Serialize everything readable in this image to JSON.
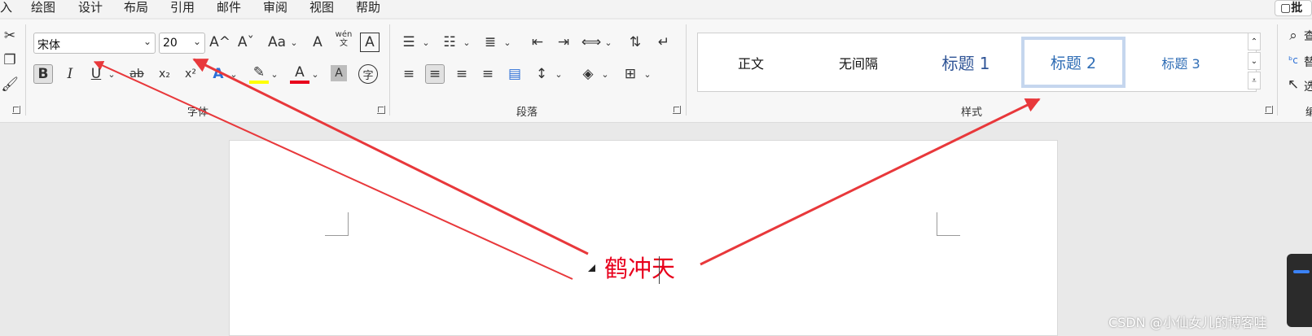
{
  "menubar": {
    "items": [
      "入",
      "绘图",
      "设计",
      "布局",
      "引用",
      "邮件",
      "审阅",
      "视图",
      "帮助"
    ],
    "comment_label": "批"
  },
  "font_group": {
    "label": "字体",
    "font_name": "宋体",
    "font_size": "20",
    "grow_font": "A^",
    "shrink_font": "Aˇ",
    "change_case": "Aa",
    "phonetic_top": "wén",
    "phonetic_bottom": "文",
    "bold": "B",
    "italic": "I",
    "underline": "U",
    "strikethrough": "ab",
    "subscript": "x₂",
    "superscript": "x²",
    "text_effects": "A",
    "font_color": "A",
    "char_shading": "A",
    "enclose_char": "字"
  },
  "paragraph_group": {
    "label": "段落"
  },
  "styles_group": {
    "label": "样式",
    "styles": [
      "正文",
      "无间隔",
      "标题 1",
      "标题 2",
      "标题 3"
    ],
    "selected": "标题 2"
  },
  "editing_group": {
    "find": "查",
    "replace": "替",
    "select": "选",
    "label": "编"
  },
  "document": {
    "text_a": "鹤冲",
    "text_b": "天"
  },
  "watermark": "CSDN @小仙女儿的博客哇",
  "colors": {
    "arrow": "#e8383b",
    "text_red": "#e8001c",
    "highlight_yellow": "#ffff00",
    "font_color_red": "#e8001c",
    "selected_style_border": "#c5d6ee"
  }
}
